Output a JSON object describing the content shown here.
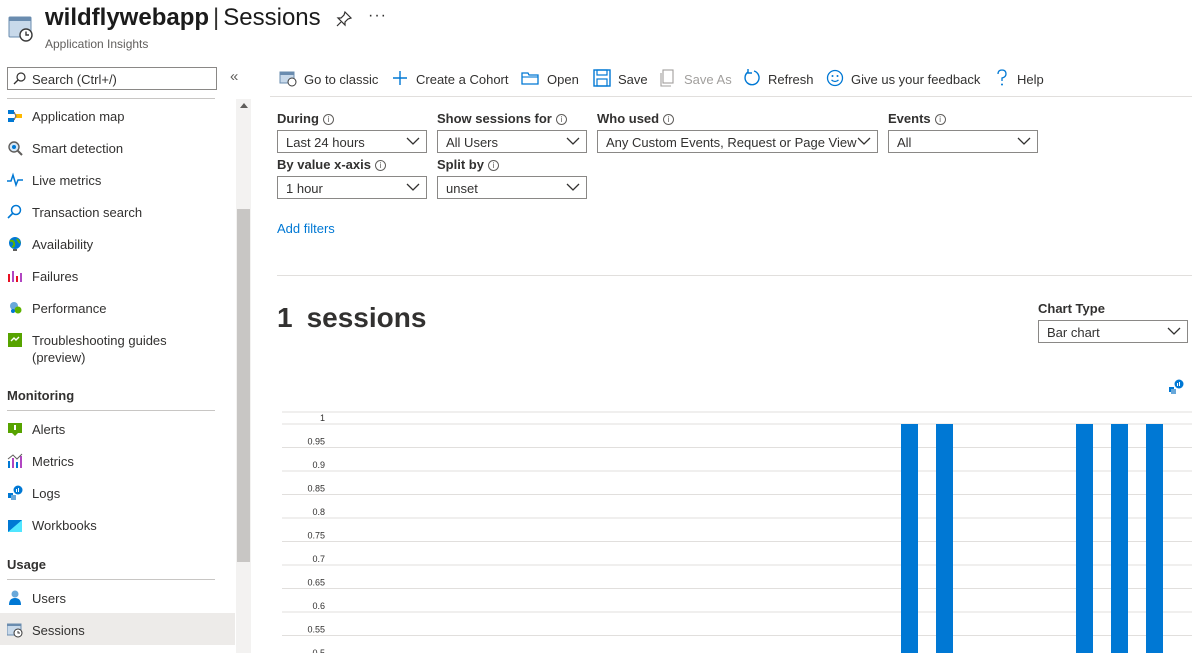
{
  "header": {
    "app_name": "wildflywebapp",
    "separator": "|",
    "page_title": "Sessions",
    "subtitle": "Application Insights",
    "more_label": "···"
  },
  "sidebar": {
    "search_placeholder": "Search (Ctrl+/)",
    "collapse_label": "«",
    "items_top": [
      {
        "label": "Application map",
        "icon": "application-map-icon"
      },
      {
        "label": "Smart detection",
        "icon": "smart-detection-icon"
      },
      {
        "label": "Live metrics",
        "icon": "live-metrics-icon"
      },
      {
        "label": "Transaction search",
        "icon": "search-icon"
      },
      {
        "label": "Availability",
        "icon": "globe-icon"
      },
      {
        "label": "Failures",
        "icon": "failures-icon"
      },
      {
        "label": "Performance",
        "icon": "performance-icon"
      },
      {
        "label": "Troubleshooting guides",
        "label2": "(preview)",
        "icon": "guide-icon"
      }
    ],
    "monitoring_header": "Monitoring",
    "monitoring_items": [
      {
        "label": "Alerts",
        "icon": "alerts-icon"
      },
      {
        "label": "Metrics",
        "icon": "metrics-icon"
      },
      {
        "label": "Logs",
        "icon": "logs-icon"
      },
      {
        "label": "Workbooks",
        "icon": "workbooks-icon"
      }
    ],
    "usage_header": "Usage",
    "usage_items": [
      {
        "label": "Users",
        "icon": "users-icon"
      },
      {
        "label": "Sessions",
        "icon": "sessions-icon"
      }
    ]
  },
  "toolbar": {
    "go_classic": "Go to classic",
    "create_cohort": "Create a Cohort",
    "open": "Open",
    "save": "Save",
    "save_as": "Save As",
    "refresh": "Refresh",
    "feedback": "Give us your feedback",
    "help": "Help"
  },
  "filters": {
    "during_label": "During",
    "during_value": "Last 24 hours",
    "show_sessions_label": "Show sessions for",
    "show_sessions_value": "All Users",
    "who_used_label": "Who used",
    "who_used_value": "Any Custom Events, Request or Page View",
    "events_label": "Events",
    "events_value": "All",
    "by_value_label": "By value x-axis",
    "by_value_value": "1 hour",
    "split_by_label": "Split by",
    "split_by_value": "unset",
    "add_filters": "Add filters"
  },
  "summary": {
    "count": "1",
    "unit": "sessions"
  },
  "chart_type": {
    "label": "Chart Type",
    "value": "Bar chart"
  },
  "colors": {
    "accent": "#0078d4",
    "bar": "#0078d4"
  },
  "chart_data": {
    "type": "bar",
    "y_ticks": [
      "1",
      "0.95",
      "0.9",
      "0.85",
      "0.8",
      "0.75",
      "0.7",
      "0.65",
      "0.6",
      "0.55",
      "0.5"
    ],
    "ylim": [
      0.5,
      1
    ],
    "values": [
      0,
      0,
      0,
      0,
      0,
      0,
      0,
      0,
      0,
      0,
      0,
      0,
      0,
      0,
      0,
      0,
      0,
      0,
      1,
      1,
      0,
      0,
      0,
      1,
      1,
      1
    ],
    "grid": true,
    "xlabel": "",
    "ylabel": ""
  }
}
